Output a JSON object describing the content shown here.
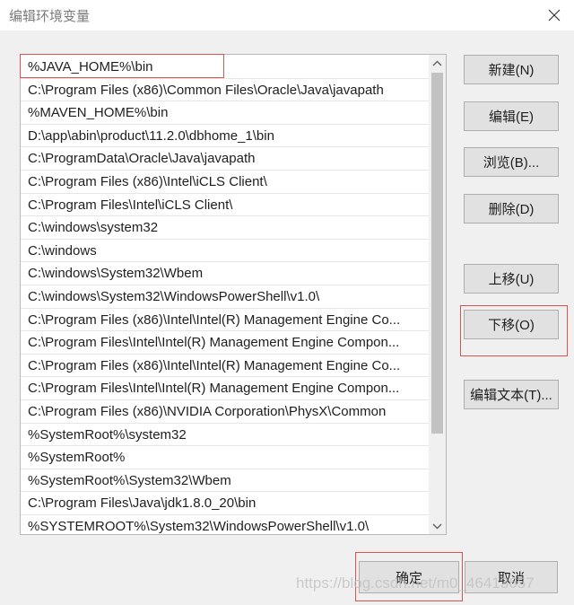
{
  "dialog": {
    "title": "编辑环境变量"
  },
  "paths": [
    "%JAVA_HOME%\\bin",
    "C:\\Program Files (x86)\\Common Files\\Oracle\\Java\\javapath",
    "%MAVEN_HOME%\\bin",
    "D:\\app\\abin\\product\\11.2.0\\dbhome_1\\bin",
    "C:\\ProgramData\\Oracle\\Java\\javapath",
    "C:\\Program Files (x86)\\Intel\\iCLS Client\\",
    "C:\\Program Files\\Intel\\iCLS Client\\",
    "C:\\windows\\system32",
    "C:\\windows",
    "C:\\windows\\System32\\Wbem",
    "C:\\windows\\System32\\WindowsPowerShell\\v1.0\\",
    "C:\\Program Files (x86)\\Intel\\Intel(R) Management Engine Co...",
    "C:\\Program Files\\Intel\\Intel(R) Management Engine Compon...",
    "C:\\Program Files (x86)\\Intel\\Intel(R) Management Engine Co...",
    "C:\\Program Files\\Intel\\Intel(R) Management Engine Compon...",
    "C:\\Program Files (x86)\\NVIDIA Corporation\\PhysX\\Common",
    "%SystemRoot%\\system32",
    "%SystemRoot%",
    "%SystemRoot%\\System32\\Wbem",
    "C:\\Program Files\\Java\\jdk1.8.0_20\\bin",
    "%SYSTEMROOT%\\System32\\WindowsPowerShell\\v1.0\\"
  ],
  "buttons": {
    "new": "新建(N)",
    "edit": "编辑(E)",
    "browse": "浏览(B)...",
    "delete": "删除(D)",
    "move_up": "上移(U)",
    "move_down": "下移(O)",
    "edit_text": "编辑文本(T)...",
    "ok": "确定",
    "cancel": "取消"
  },
  "icons": {
    "close": "close-icon",
    "scroll_up": "chevron-up-icon",
    "scroll_down": "chevron-down-icon"
  },
  "colors": {
    "highlight": "#d9534f",
    "background": "#f0f0f0",
    "button": "#e1e1e1"
  },
  "watermark": "https://blog.csdn.net/m0_46413657"
}
